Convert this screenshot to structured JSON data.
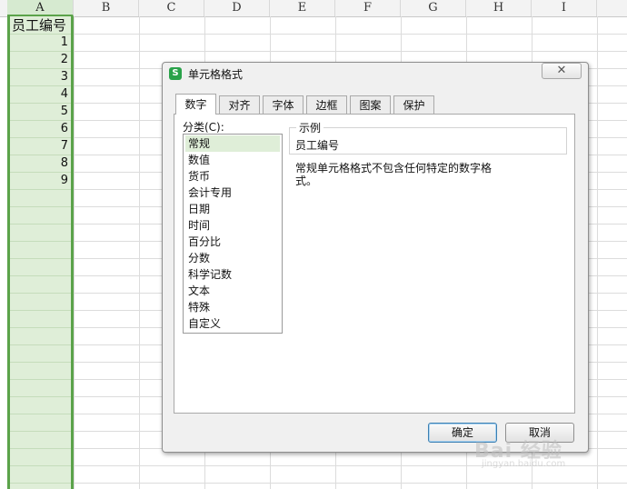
{
  "sheet": {
    "columns": [
      "A",
      "B",
      "C",
      "D",
      "E",
      "F",
      "G",
      "H",
      "I"
    ],
    "colA_header_cell": "员工编号",
    "colA_values": [
      "1",
      "2",
      "3",
      "4",
      "5",
      "6",
      "7",
      "8",
      "9"
    ]
  },
  "dialog": {
    "title": "单元格格式",
    "app_icon": "S",
    "close_icon": "✕",
    "tabs": [
      "数字",
      "对齐",
      "字体",
      "边框",
      "图案",
      "保护"
    ],
    "active_tab": "数字",
    "category_label": "分类(C):",
    "categories": [
      "常规",
      "数值",
      "货币",
      "会计专用",
      "日期",
      "时间",
      "百分比",
      "分数",
      "科学记数",
      "文本",
      "特殊",
      "自定义"
    ],
    "selected_category": "常规",
    "sample_legend": "示例",
    "sample_value": "员工编号",
    "description": "常规单元格格式不包含任何特定的数字格式。",
    "ok_label": "确定",
    "cancel_label": "取消"
  },
  "watermark": {
    "text": "Bai 经验",
    "sub": "jingyan.baidu.com"
  },
  "colors": {
    "selection_green": "#5ba34a",
    "selection_fill": "#dfeed8",
    "app_icon_green": "#2aa24a"
  }
}
